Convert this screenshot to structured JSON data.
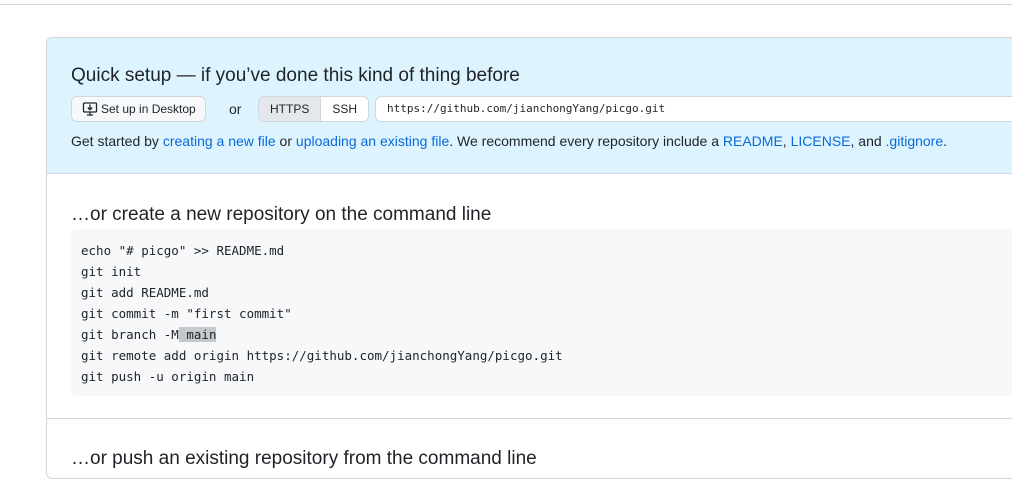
{
  "quick_setup": {
    "title": "Quick setup — if you’ve done this kind of thing before",
    "desktop_button_label": "Set up in Desktop",
    "or_label": "or",
    "protocols": [
      "HTTPS",
      "SSH"
    ],
    "selected_protocol": "HTTPS",
    "clone_url": "https://github.com/jianchongYang/picgo.git",
    "desc": {
      "prefix": "Get started by ",
      "link_new_file": "creating a new file",
      "mid1": " or ",
      "link_upload": "uploading an existing file",
      "mid2": ". We recommend every repository include a ",
      "link_readme": "README",
      "comma1": ", ",
      "link_license": "LICENSE",
      "mid3": ", and ",
      "link_gitignore": ".gitignore",
      "suffix": "."
    }
  },
  "new_repo": {
    "title": "…or create a new repository on the command line",
    "lines": [
      "echo \"# picgo\" >> README.md",
      "git init",
      "git add README.md",
      "git commit -m \"first commit\"",
      "git remote add origin https://github.com/jianchongYang/picgo.git",
      "git push -u origin main"
    ],
    "branch_line_prefix": "git branch -M",
    "branch_line_selected": " main"
  },
  "push_existing": {
    "title": "…or push an existing repository from the command line"
  },
  "colors": {
    "link": "#0969da",
    "quick_setup_bg": "#ddf4ff",
    "code_bg": "#f6f8fa",
    "border": "#d0d7de"
  },
  "icons": {
    "desktop": "desktop-download-icon"
  }
}
